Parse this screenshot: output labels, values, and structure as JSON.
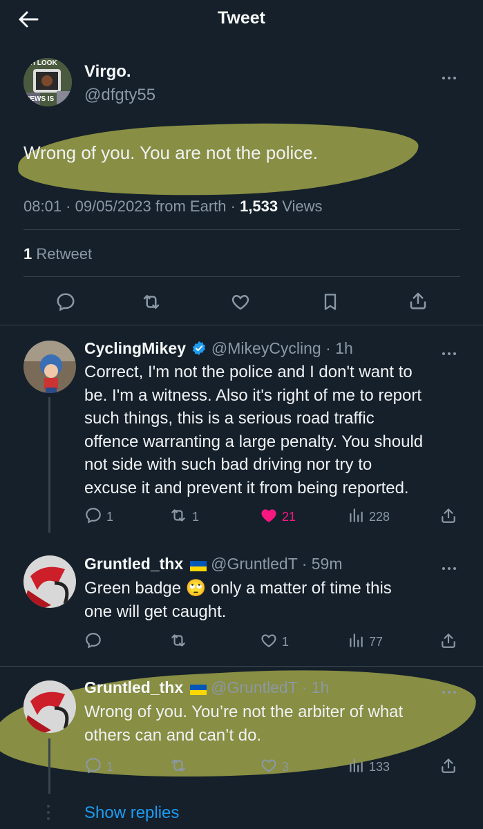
{
  "header": {
    "title": "Tweet"
  },
  "main_tweet": {
    "display_name": "Virgo.",
    "handle": "@dfgty55",
    "avatar_text_top": "OH LOOK",
    "avatar_text_bottom": "NEWS IS",
    "text": "Wrong of you. You are not the police.",
    "time": "08:01 · 09/05/2023 from Earth · ",
    "views_count": "1,533",
    "views_label": " Views",
    "retweets_count": "1",
    "retweets_label": " Retweet"
  },
  "replies": [
    {
      "display_name": "CyclingMikey",
      "handle": "@MikeyCycling · 1h",
      "text": "Correct, I'm not the police and I don't want to\nbe. I'm a witness. Also it's right of me to report\nsuch things, this is a serious road traffic\noffence warranting a large penalty. You should\nnot side with such bad driving nor try to\nexcuse it and prevent it from being reported.",
      "reply_count": "1",
      "retweet_count": "1",
      "like_count": "21",
      "view_count": "228"
    },
    {
      "display_name": "Gruntled_thx",
      "handle": "@GruntledT · 59m",
      "text_before_emoji": "Green badge ",
      "emoji": "🙄",
      "text_after_emoji": " only a matter of time this\none will get caught.",
      "reply_count": "",
      "retweet_count": "",
      "like_count": "1",
      "view_count": "77"
    },
    {
      "display_name": "Gruntled_thx",
      "handle": "@GruntledT · 1h",
      "text": "Wrong of you. You’re not the arbiter of what\nothers can and can’t do.",
      "reply_count": "1",
      "retweet_count": "",
      "like_count": "3",
      "view_count": "133"
    }
  ],
  "show_replies": "Show replies",
  "colors": {
    "background": "#15202b",
    "accent_blue": "#1d9bf0",
    "like_pink": "#f91880",
    "highlighter": "#b6b94c",
    "flag_blue": "#0057b7",
    "flag_yellow": "#ffd700"
  },
  "icons": [
    "back-arrow-icon",
    "more-icon",
    "reply-icon",
    "retweet-icon",
    "like-icon",
    "bookmark-icon",
    "share-icon",
    "views-icon",
    "verified-badge-icon",
    "ukraine-flag-icon"
  ]
}
